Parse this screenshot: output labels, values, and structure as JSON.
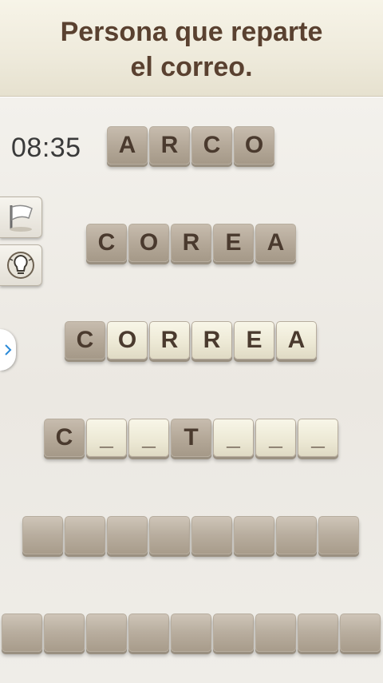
{
  "clue": {
    "line1": "Persona que reparte",
    "line2": "el correo."
  },
  "timer": "08:35",
  "rows": [
    {
      "tiles": [
        {
          "t": "A",
          "s": "dark"
        },
        {
          "t": "R",
          "s": "dark"
        },
        {
          "t": "C",
          "s": "dark"
        },
        {
          "t": "O",
          "s": "dark"
        }
      ]
    },
    {
      "tiles": [
        {
          "t": "C",
          "s": "dark"
        },
        {
          "t": "O",
          "s": "dark"
        },
        {
          "t": "R",
          "s": "dark"
        },
        {
          "t": "E",
          "s": "dark"
        },
        {
          "t": "A",
          "s": "dark"
        }
      ]
    },
    {
      "tiles": [
        {
          "t": "C",
          "s": "dark"
        },
        {
          "t": "O",
          "s": "light"
        },
        {
          "t": "R",
          "s": "light"
        },
        {
          "t": "R",
          "s": "light"
        },
        {
          "t": "E",
          "s": "light"
        },
        {
          "t": "A",
          "s": "light"
        }
      ]
    },
    {
      "tiles": [
        {
          "t": "C",
          "s": "dark"
        },
        {
          "t": "_",
          "s": "light"
        },
        {
          "t": "_",
          "s": "light"
        },
        {
          "t": "T",
          "s": "dark"
        },
        {
          "t": "_",
          "s": "light"
        },
        {
          "t": "_",
          "s": "light"
        },
        {
          "t": "_",
          "s": "light"
        }
      ]
    },
    {
      "tiles": [
        {
          "t": "",
          "s": "dark"
        },
        {
          "t": "",
          "s": "dark"
        },
        {
          "t": "",
          "s": "dark"
        },
        {
          "t": "",
          "s": "dark"
        },
        {
          "t": "",
          "s": "dark"
        },
        {
          "t": "",
          "s": "dark"
        },
        {
          "t": "",
          "s": "dark"
        },
        {
          "t": "",
          "s": "dark"
        }
      ]
    },
    {
      "tiles": [
        {
          "t": "",
          "s": "dark"
        },
        {
          "t": "",
          "s": "dark"
        },
        {
          "t": "",
          "s": "dark"
        },
        {
          "t": "",
          "s": "dark"
        },
        {
          "t": "",
          "s": "dark"
        },
        {
          "t": "",
          "s": "dark"
        },
        {
          "t": "",
          "s": "dark"
        },
        {
          "t": "",
          "s": "dark"
        },
        {
          "t": "",
          "s": "dark"
        }
      ]
    }
  ],
  "side_buttons": [
    {
      "icon": "flag-icon"
    },
    {
      "icon": "lightbulb-hint-icon"
    }
  ],
  "edge_tab_icon": "chevron-right-icon"
}
